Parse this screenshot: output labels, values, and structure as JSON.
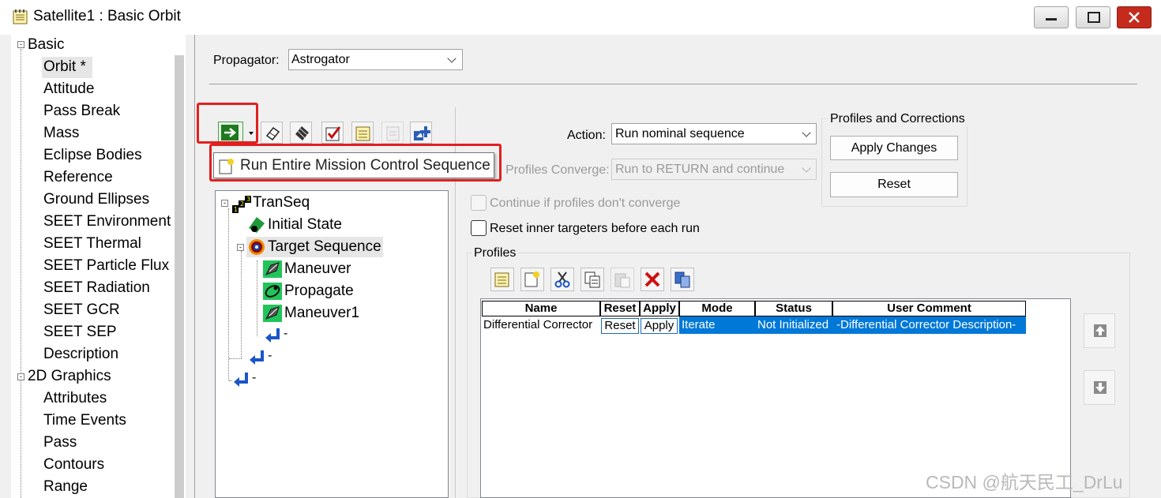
{
  "window": {
    "title": "Satellite1 : Basic Orbit"
  },
  "left_tree": {
    "groups": [
      {
        "label": "Basic",
        "items": [
          "Orbit *",
          "Attitude",
          "Pass Break",
          "Mass",
          "Eclipse Bodies",
          "Reference",
          "Ground Ellipses",
          "SEET Environment",
          "SEET Thermal",
          "SEET Particle Flux",
          "SEET Radiation",
          "SEET GCR",
          "SEET SEP",
          "Description"
        ]
      },
      {
        "label": "2D Graphics",
        "items": [
          "Attributes",
          "Time Events",
          "Pass",
          "Contours",
          "Range"
        ]
      }
    ],
    "selected": "Orbit *"
  },
  "propagator": {
    "label": "Propagator:",
    "value": "Astrogator"
  },
  "toolbar": {
    "tooltip": "Run Entire Mission Control Sequence"
  },
  "mcs_tree": {
    "root": "TranSeq",
    "initial_state": "Initial State",
    "target_sequence": "Target Sequence",
    "children": [
      "Maneuver",
      "Propagate",
      "Maneuver1"
    ],
    "return_label": "-"
  },
  "action": {
    "label": "Action:",
    "value": "Run nominal sequence"
  },
  "profiles_converge": {
    "label": "Profiles Converge:",
    "value": "Run to RETURN and continue"
  },
  "checkboxes": {
    "continue_if": "Continue if profiles don't converge",
    "reset_inner": "Reset inner targeters before each run"
  },
  "profiles_corrections": {
    "title": "Profiles and Corrections",
    "apply_changes": "Apply Changes",
    "reset": "Reset"
  },
  "profiles": {
    "title": "Profiles",
    "columns": [
      "Name",
      "Reset",
      "Apply",
      "Mode",
      "Status",
      "User Comment"
    ],
    "rows": [
      {
        "name": "Differential Corrector",
        "reset": "Reset",
        "apply": "Apply",
        "mode": "Iterate",
        "status": "Not Initialized",
        "comment": "-Differential Corrector Description-"
      }
    ]
  },
  "watermark": "CSDN @航天民工_DrLu",
  "colors": {
    "highlight_box": "#e02020",
    "selection": "#0078d7"
  }
}
